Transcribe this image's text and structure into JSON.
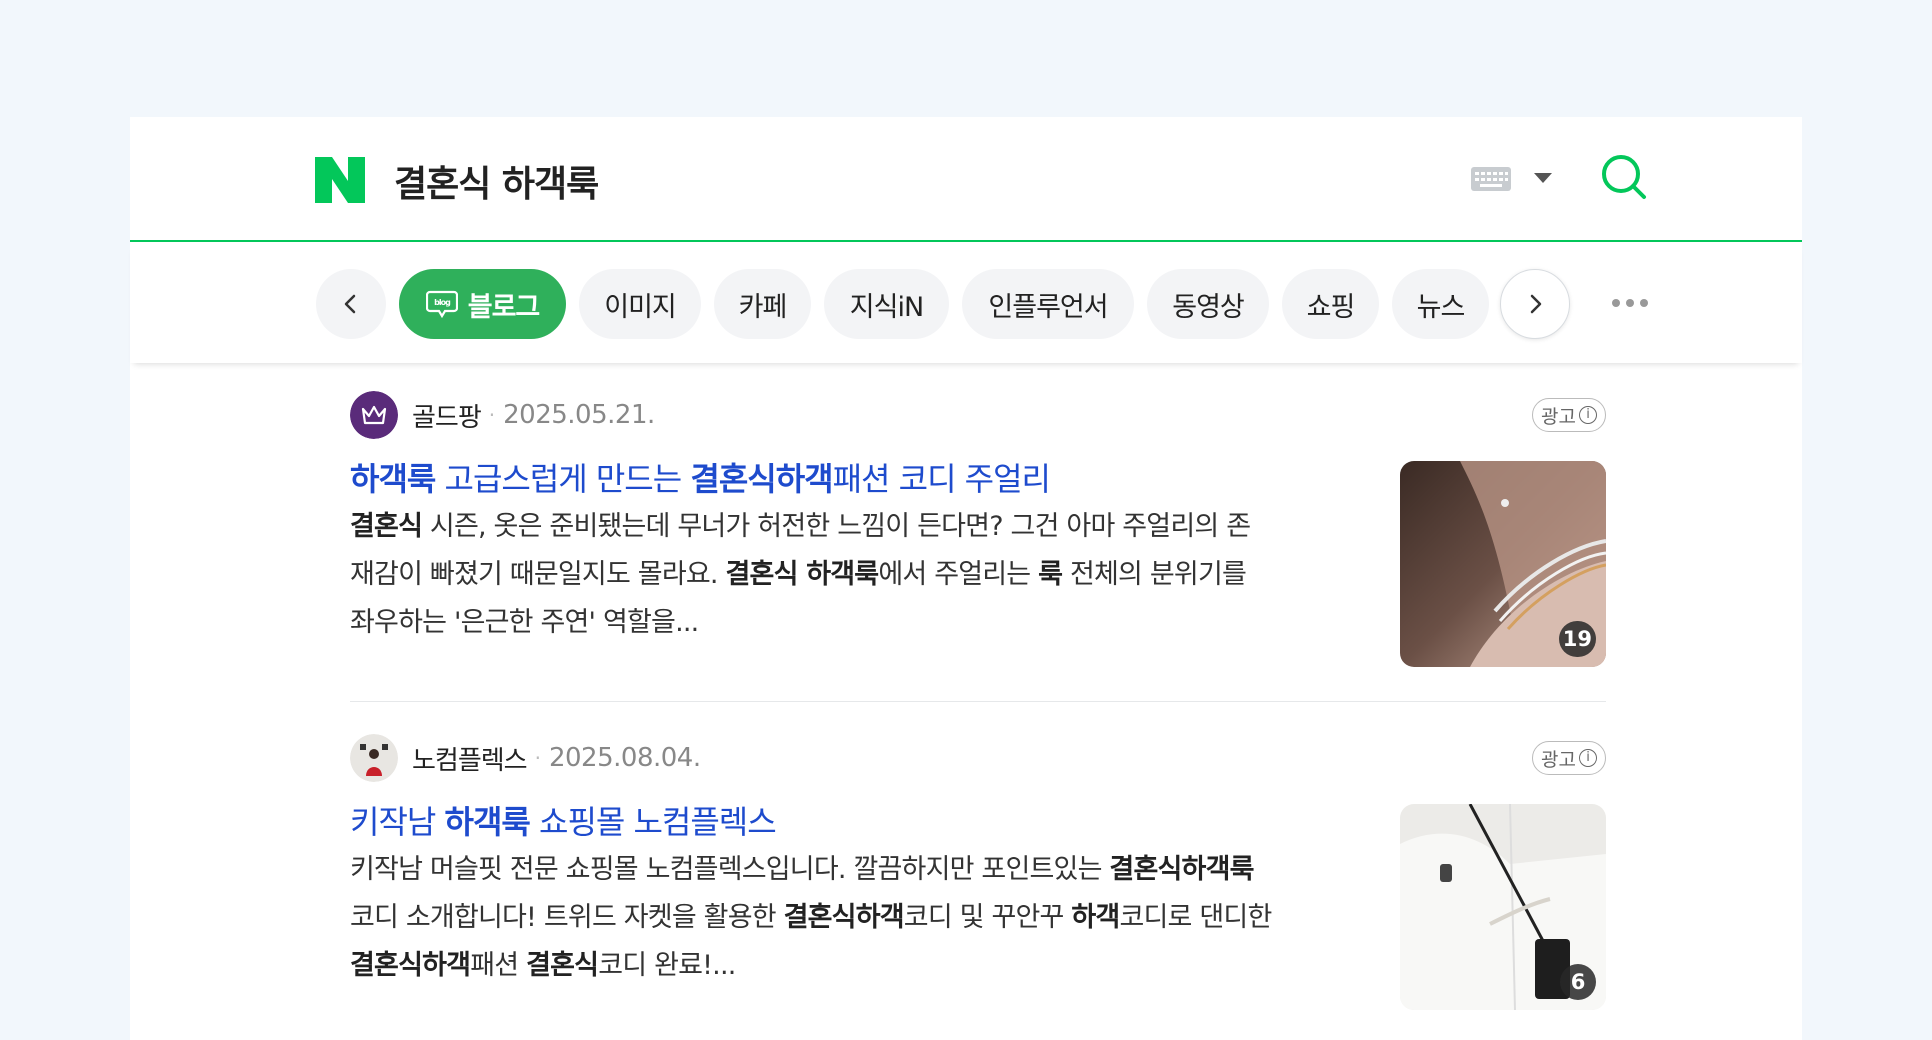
{
  "header": {
    "query": "결혼식 하객룩"
  },
  "tabs": {
    "items": [
      {
        "label": "블로그",
        "active": true
      },
      {
        "label": "이미지"
      },
      {
        "label": "카페"
      },
      {
        "label": "지식iN"
      },
      {
        "label": "인플루언서"
      },
      {
        "label": "동영상"
      },
      {
        "label": "쇼핑"
      },
      {
        "label": "뉴스"
      }
    ]
  },
  "results": [
    {
      "author": "골드팡",
      "date": "2025.05.21.",
      "ad_label": "광고",
      "title_parts": [
        "하객룩",
        " 고급스럽게 만드는 ",
        "결혼식하객",
        "패션 코디 주얼리"
      ],
      "desc_lines": [
        [
          "결혼식",
          " 시즌, 옷은 준비됐는데 무너가 허전한 느낌이 든다면? 그건 아마 주얼리의 존"
        ],
        [
          "재감이 빠졌기 때문일지도 몰라요. ",
          "결혼식 하객룩",
          "에서 주얼리는 ",
          "룩",
          " 전체의 분위기를"
        ],
        [
          "좌우하는 '은근한 주연' 역할을..."
        ]
      ],
      "image_count": "19"
    },
    {
      "author": "노컴플렉스",
      "date": "2025.08.04.",
      "ad_label": "광고",
      "title_parts": [
        "키작남 ",
        "하객룩",
        " 쇼핑몰 노컴플렉스"
      ],
      "desc_lines": [
        [
          "키작남 머슬핏 전문 쇼핑몰 노컴플렉스입니다. 깔끔하지만 포인트있는 ",
          "결혼식하객룩"
        ],
        [
          "코디 소개합니다! 트위드 자켓을 활용한 ",
          "결혼식하객",
          "코디 및 꾸안꾸 ",
          "하객",
          "코디로 댄디한"
        ],
        [
          "결혼식하객",
          "패션 ",
          "결혼식",
          "코디 완료!..."
        ]
      ],
      "image_count": "6"
    }
  ],
  "colors": {
    "brand_green": "#03c75a",
    "active_tab": "#2fb05b",
    "link_blue": "#1e4bcd"
  }
}
